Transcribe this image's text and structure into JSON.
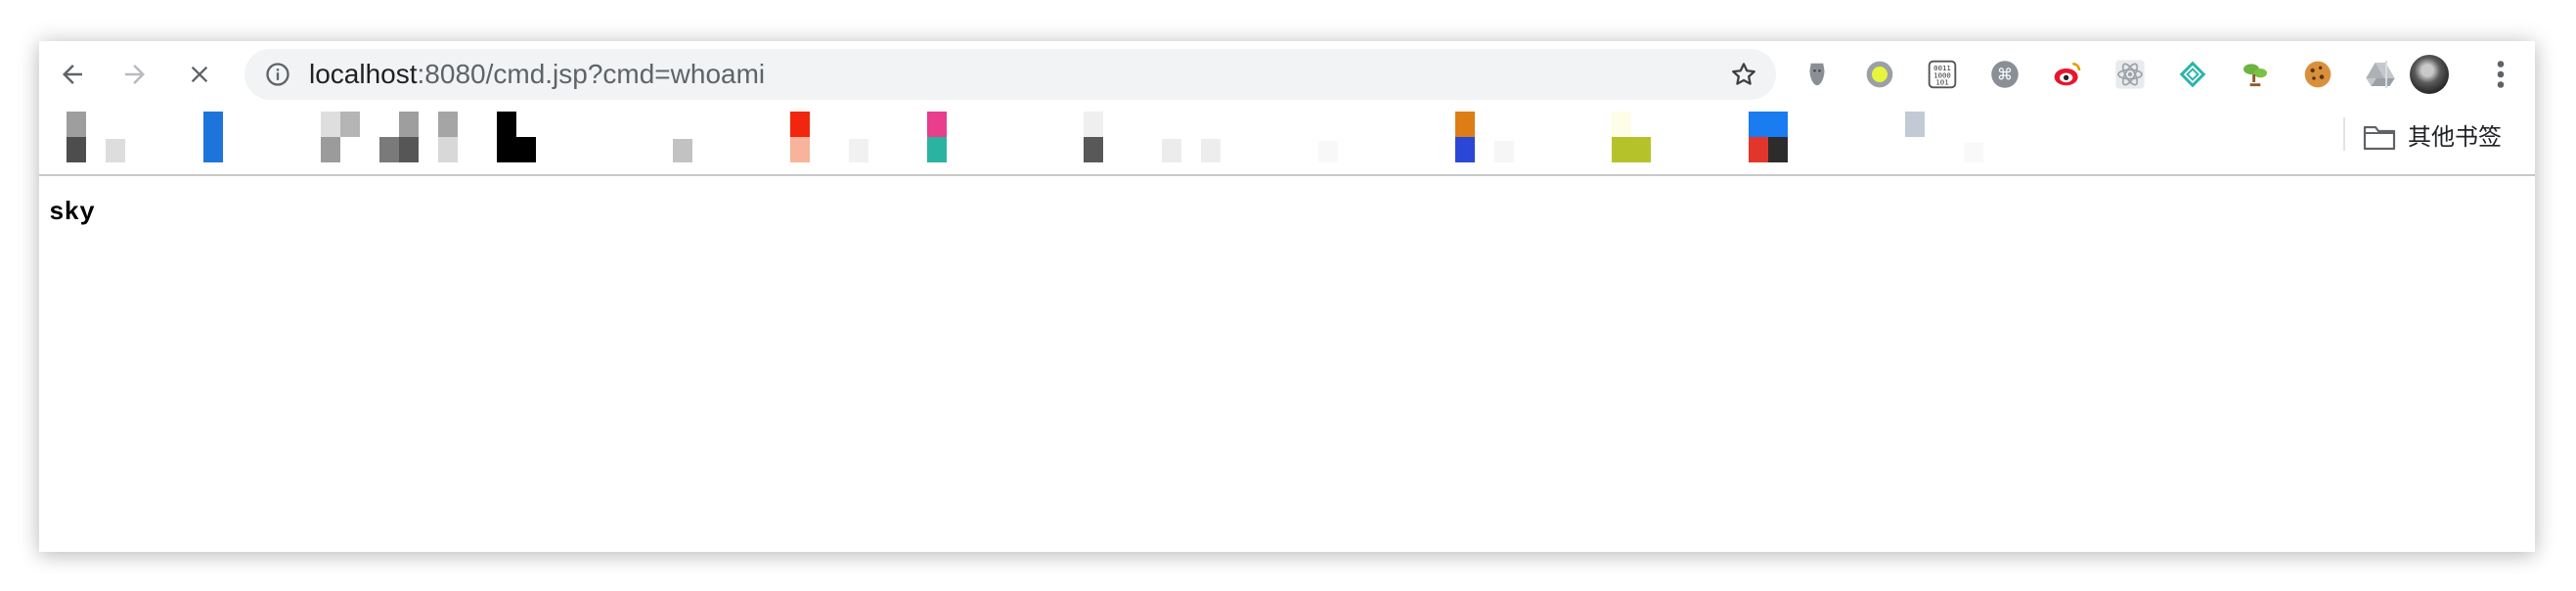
{
  "browser": {
    "address_host": "localhost",
    "address_path": ":8080/cmd.jsp?cmd=whoami",
    "icons": {
      "back": "back-arrow-icon",
      "forward": "forward-arrow-icon",
      "stop": "stop-loading-icon",
      "info": "site-info-icon",
      "star": "bookmark-star-icon"
    },
    "extensions": [
      "mask-extension-icon",
      "yellow-dot-extension-icon",
      "binary-extension-icon",
      "command-extension-icon",
      "weibo-extension-icon",
      "react-extension-icon",
      "diamond-extension-icon",
      "bonsai-extension-icon",
      "cookie-extension-icon",
      "drive-extension-icon"
    ],
    "other_bookmarks_label": "其他书签"
  },
  "page": {
    "output": "sky"
  }
}
